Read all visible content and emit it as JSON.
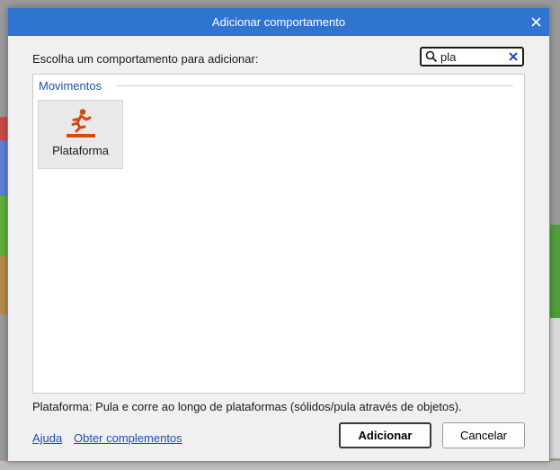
{
  "dialog": {
    "title": "Adicionar comportamento",
    "prompt": "Escolha um comportamento para adicionar:",
    "search": {
      "value": "pla",
      "placeholder": ""
    },
    "category": "Movimentos",
    "behaviors": [
      {
        "label": "Plataforma",
        "icon": "platform-runner-icon",
        "color": "#d24a12"
      }
    ],
    "description": "Plataforma: Pula e corre ao longo de plataformas (sólidos/pula através de objetos).",
    "links": {
      "help": "Ajuda",
      "addons": "Obter complementos"
    },
    "buttons": {
      "add": "Adicionar",
      "cancel": "Cancelar"
    }
  },
  "colors": {
    "titlebar": "#2f74d0",
    "link": "#1d4fb3",
    "icon": "#d24a12"
  }
}
